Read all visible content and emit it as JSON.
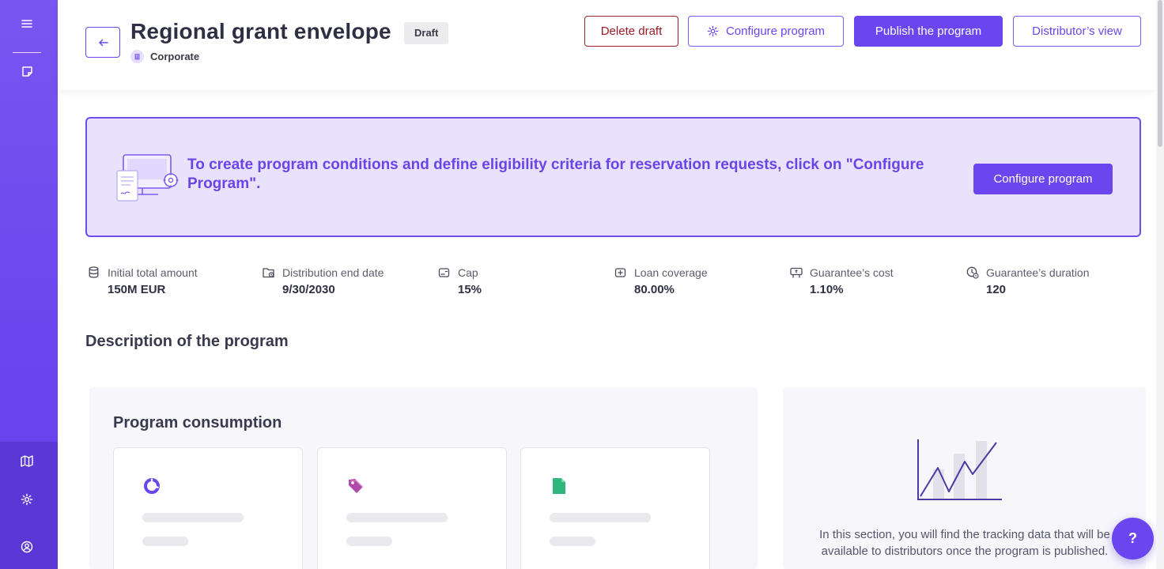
{
  "sidebar": {
    "icons": [
      "menu-icon",
      "note-icon",
      "map-icon",
      "settings-icon",
      "user-icon"
    ]
  },
  "header": {
    "title": "Regional grant envelope",
    "status_badge": "Draft",
    "organization": "Corporate",
    "buttons": {
      "delete": "Delete draft",
      "configure": "Configure program",
      "publish": "Publish the program",
      "distributor": "Distributor’s view"
    }
  },
  "banner": {
    "text": "To create program conditions and define eligibility criteria for reservation requests, click on \"Configure Program\".",
    "button": "Configure program"
  },
  "stats": [
    {
      "label": "Initial total amount",
      "value": "150M EUR",
      "icon": "database-icon"
    },
    {
      "label": "Distribution end date",
      "value": "9/30/2030",
      "icon": "calendar-folder-icon"
    },
    {
      "label": "Cap",
      "value": "15%",
      "icon": "cap-icon"
    },
    {
      "label": "Loan coverage",
      "value": "80.00%",
      "icon": "coverage-icon"
    },
    {
      "label": "Guarantee’s cost",
      "value": "1.10%",
      "icon": "cost-icon"
    },
    {
      "label": "Guarantee’s duration",
      "value": "120",
      "icon": "clock-icon"
    }
  ],
  "description": {
    "title": "Description of the program"
  },
  "consumption": {
    "title": "Program consumption",
    "cards": [
      {
        "icon": "donut-chart-icon"
      },
      {
        "icon": "tag-icon"
      },
      {
        "icon": "document-icon"
      }
    ]
  },
  "tracking": {
    "text": "In this section, you will find the tracking data that will be available to distributors once the program is published."
  },
  "help": {
    "label": "?"
  },
  "colors": {
    "accent": "#6b46ee",
    "danger": "#9b1b25",
    "banner_bg": "#e9e2fd"
  }
}
